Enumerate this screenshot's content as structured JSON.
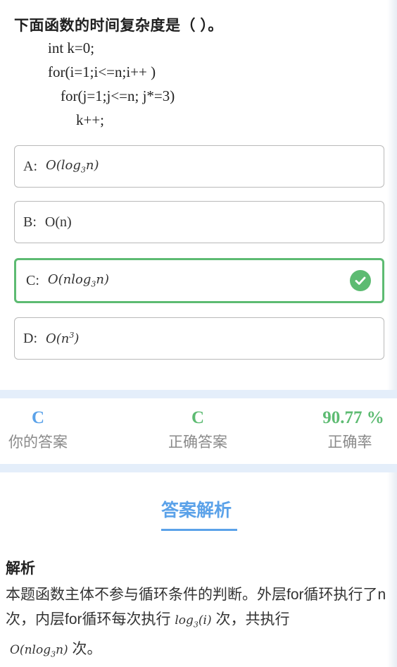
{
  "question": {
    "title": "下面函数的时间复杂度是（ ）。",
    "code": [
      "int k=0;",
      "for(i=1;i<=n;i++ )",
      "for(j=1;j<=n; j*=3)",
      "k++;"
    ]
  },
  "options": [
    {
      "letter": "A:",
      "math": "O(log",
      "sub": "3",
      "tail": "n)",
      "correct": false
    },
    {
      "letter": "B:",
      "text": "O(n)",
      "correct": false
    },
    {
      "letter": "C:",
      "math": "O(nlog",
      "sub": "3",
      "tail": "n)",
      "correct": true
    },
    {
      "letter": "D:",
      "math": "O(n",
      "sup": "3",
      "tail": ")",
      "correct": false
    }
  ],
  "stats": {
    "your_answer": {
      "value": "C",
      "label": "你的答案",
      "color": "#5ba2e9"
    },
    "correct_answer": {
      "value": "C",
      "label": "正确答案",
      "color": "#5dbb72"
    },
    "accuracy": {
      "value": "90.77 %",
      "label": "正确率",
      "color": "#5dbb72"
    }
  },
  "analysis": {
    "tab_label": "答案解析",
    "heading": "解析",
    "text_part1": "本题函数主体不参与循环条件的判断。外层for循环执行了n次，内层for循环每次执行 ",
    "math1": "log",
    "math1_sub": "3",
    "math1_tail": "(i)",
    "text_part2": " 次，共执行",
    "math2": "O(nlog",
    "math2_sub": "3",
    "math2_tail": "n)",
    "text_part3": " 次。"
  },
  "colors": {
    "accent": "#5ba2e9",
    "correct": "#5dbb72",
    "band": "#e4eefa"
  }
}
